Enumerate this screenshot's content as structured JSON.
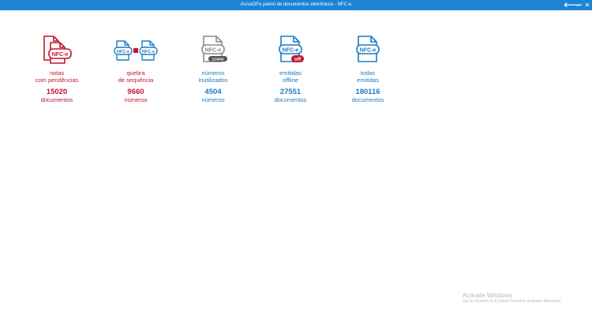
{
  "window": {
    "title": "AcruxDFe painel de documentos eletrônicos - NFC-e",
    "controls": {
      "back": "🡐",
      "minimize": "_",
      "close": "✕"
    }
  },
  "tiles": [
    {
      "label": "notas\ncom pendências",
      "count": "15020",
      "unit": "documentos",
      "color": "#c4152d",
      "icon": "nfce-pending-icon",
      "badge": "NFC-e"
    },
    {
      "label": "quebra\nde sequência",
      "count": "9660",
      "unit": "números",
      "color": "#c4152d",
      "icon": "nfce-sequence-break-icon",
      "badge": "NFC-e"
    },
    {
      "label": "números\ninutilizados",
      "count": "4504",
      "unit": "números",
      "color": "#1b7cc4",
      "icon": "nfce-disabled-numbers-icon",
      "badge": "NFC-e",
      "sub_badge": "123456"
    },
    {
      "label": "emitidas\noffline",
      "count": "27551",
      "unit": "documentos",
      "color": "#1b7cc4",
      "icon": "nfce-offline-icon",
      "badge": "NFC-e",
      "sub_badge": "off"
    },
    {
      "label": "todas\nemitidas",
      "count": "180116",
      "unit": "documentos",
      "color": "#1b7cc4",
      "icon": "nfce-all-icon",
      "badge": "NFC-e"
    }
  ],
  "watermark": {
    "title": "Activate Windows",
    "subtitle": "Go to System in Control Panel to activate Windows."
  }
}
